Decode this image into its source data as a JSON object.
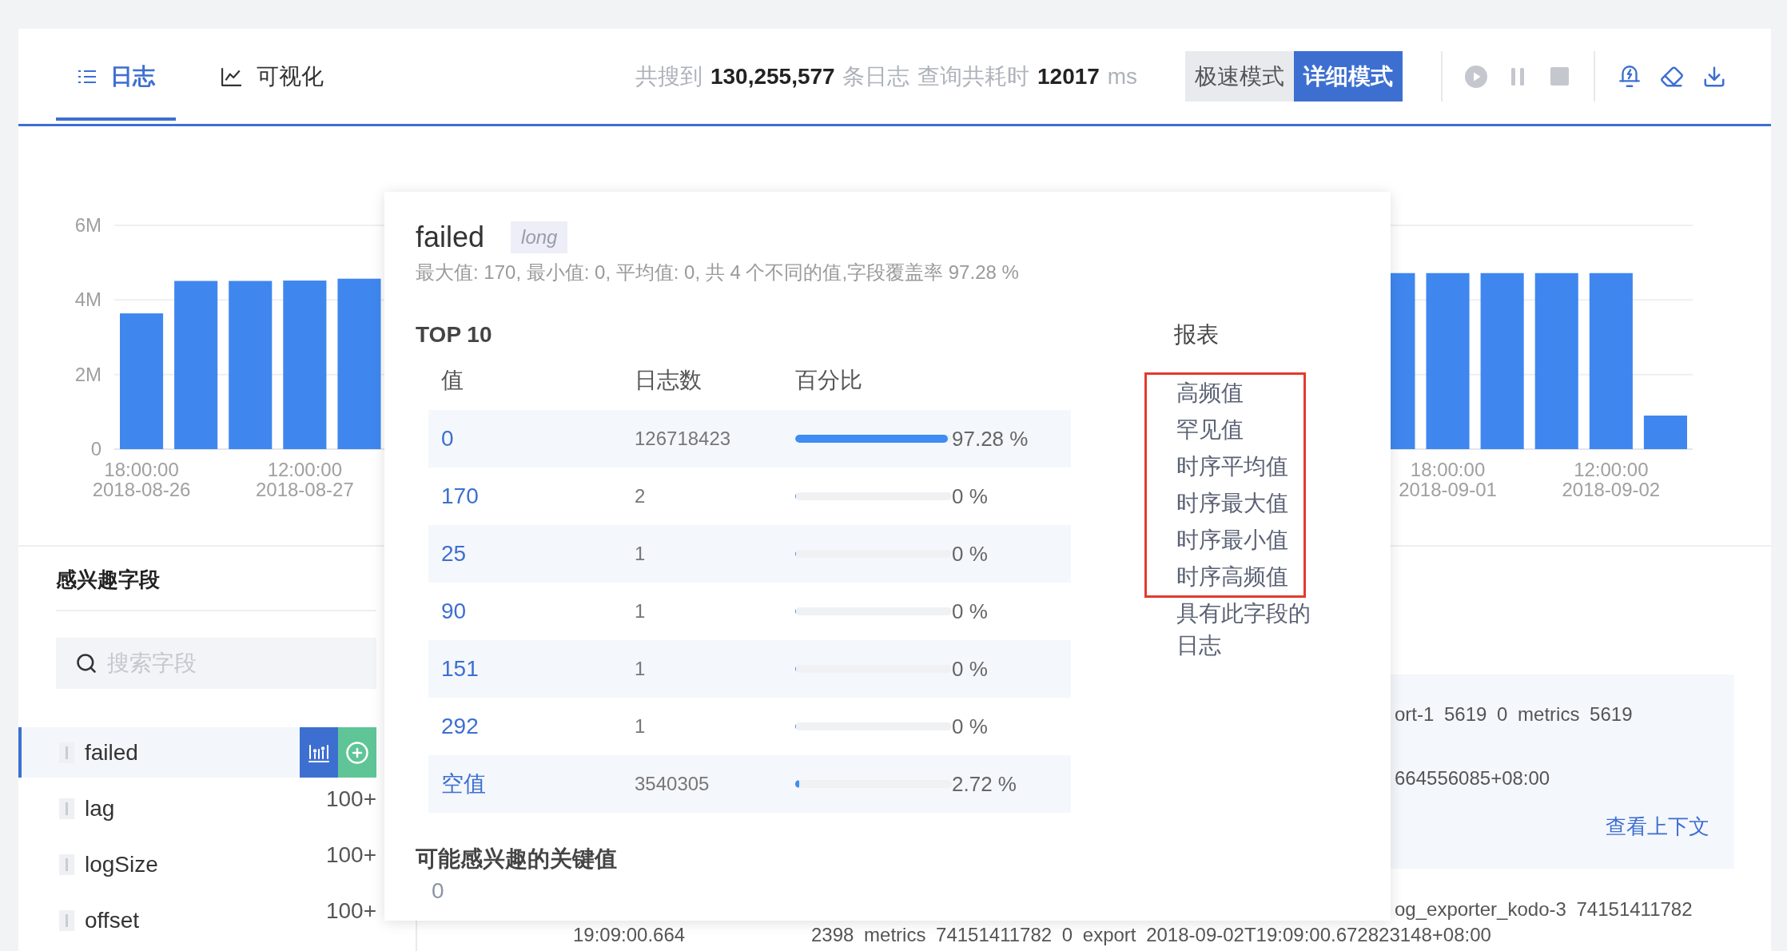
{
  "tabs": [
    {
      "label": "日志",
      "selected": true
    },
    {
      "label": "可视化",
      "selected": false
    }
  ],
  "stats": "共搜到 **130,255,577** 条日志 查询共耗时 **12017** ms",
  "modes": [
    {
      "label": "极速模式",
      "selected": false
    },
    {
      "label": "详细模式",
      "selected": true
    }
  ],
  "toolbar": [
    {
      "buttons": [
        {
          "disabled": true
        },
        {
          "disabled": true
        },
        {
          "disabled": true
        }
      ]
    },
    {
      "buttons": [
        {
          "disabled": false
        },
        {
          "disabled": false
        },
        {
          "disabled": false
        }
      ]
    }
  ],
  "histogram": {
    "chart_data": {
      "type": "bar",
      "categories": [
        "18:00:00 2018-08-26",
        null,
        null,
        "12:00:00 2018-08-27",
        null,
        null,
        null,
        null,
        null,
        null,
        null,
        null,
        null,
        null,
        null,
        null,
        null,
        null,
        null,
        null,
        null,
        null,
        null,
        null,
        "18:00:00 2018-09-01",
        null,
        null,
        "12:00:00 2018-09-02",
        null
      ],
      "values": [
        3640000,
        4510000,
        4510000,
        4520000,
        4570000,
        null,
        null,
        null,
        null,
        null,
        null,
        null,
        null,
        null,
        null,
        null,
        null,
        null,
        null,
        null,
        null,
        null,
        null,
        4720000,
        4720000,
        4720000,
        4720000,
        4720000,
        900000
      ],
      "ylim": [
        0,
        6000000
      ],
      "yticks": [
        {
          "value": 0,
          "label": "0"
        },
        {
          "value": 2000000,
          "label": "2M"
        },
        {
          "value": 4000000,
          "label": "4M"
        },
        {
          "value": 6000000,
          "label": "6M"
        }
      ]
    }
  },
  "fields_panel": {
    "title": "感兴趣字段",
    "search": {
      "placeholder": "搜索字段"
    },
    "fields": [
      {
        "name": "failed",
        "selected": true
      },
      {
        "name": "lag",
        "count": "100+",
        "selected": false
      },
      {
        "name": "logSize",
        "count": "100+",
        "selected": false
      },
      {
        "name": "offset",
        "count": "100+",
        "selected": false
      }
    ]
  },
  "logs": [
    {
      "selected": true,
      "lines": [
        "ort-1 5619 0 metrics 5619",
        "664556085+08:00"
      ],
      "link": "查看上下文"
    },
    {
      "selected": false,
      "lines": [
        "og_exporter_kodo-3 74151411782"
      ],
      "time": "19:09:00.664",
      "message": "2398 metrics 74151411782 0 export 2018-09-02T19:09:00.672823148+08:00"
    }
  ],
  "field_popup": {
    "title": "failed",
    "type": "long",
    "summary": "最大值: 170, 最小值: 0, 平均值: 0, 共 4 个不同的值,字段覆盖率 97.28 %",
    "top_title": "TOP 10",
    "columns": [
      "值",
      "日志数",
      "百分比"
    ],
    "rows": [
      {
        "value": "0",
        "count": "126718423",
        "level": 0.9728,
        "percent": "97.28 %"
      },
      {
        "value": "170",
        "count": "2",
        "level": 0,
        "percent": "0 %"
      },
      {
        "value": "25",
        "count": "1",
        "level": 0,
        "percent": "0 %"
      },
      {
        "value": "90",
        "count": "1",
        "level": 0,
        "percent": "0 %"
      },
      {
        "value": "151",
        "count": "1",
        "level": 0,
        "percent": "0 %"
      },
      {
        "value": "292",
        "count": "1",
        "level": 0,
        "percent": "0 %"
      },
      {
        "value": "空值",
        "count": "3540305",
        "level": 0.0272,
        "percent": "2.72 %"
      }
    ],
    "reports_title": "报表",
    "reports": [
      {
        "label": "高频值",
        "highlighted": true
      },
      {
        "label": "罕见值",
        "highlighted": true
      },
      {
        "label": "时序平均值",
        "highlighted": true
      },
      {
        "label": "时序最大值",
        "highlighted": true
      },
      {
        "label": "时序最小值",
        "highlighted": true
      },
      {
        "label": "时序高频值",
        "highlighted": true
      },
      {
        "label": "具有此字段的日志",
        "highlighted": false
      }
    ],
    "keywords_title": "可能感兴趣的关键值",
    "keywords": [
      "0"
    ]
  }
}
